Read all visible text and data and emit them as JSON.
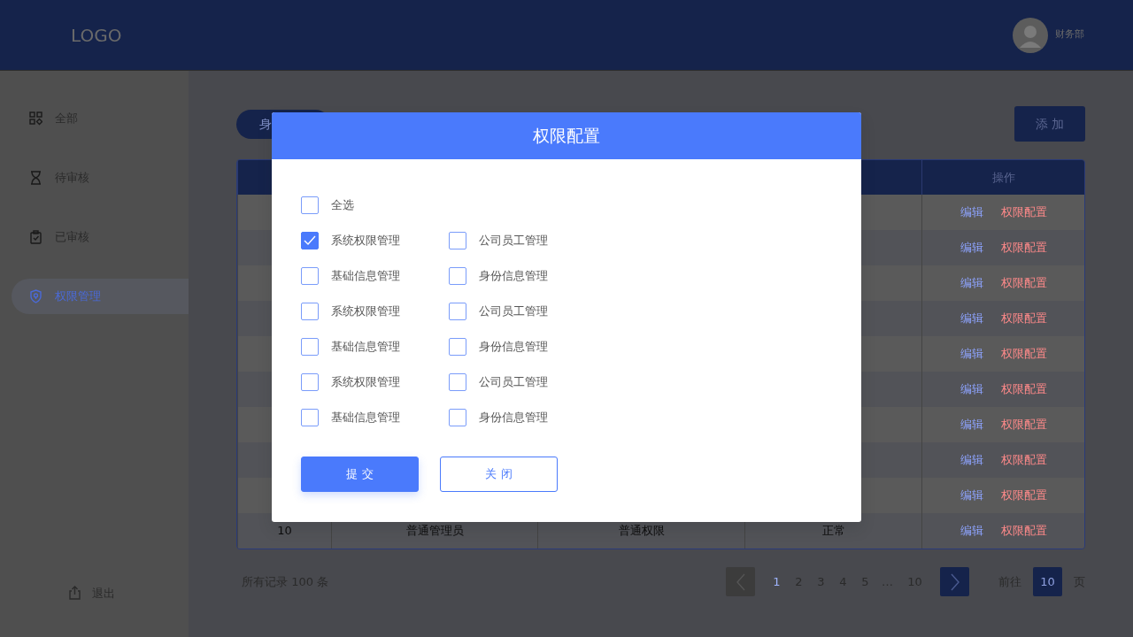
{
  "header": {
    "logo": "LOGO",
    "department": "财务部"
  },
  "sidebar": {
    "items": [
      {
        "label": "全部",
        "selected": false
      },
      {
        "label": "待审核",
        "selected": false
      },
      {
        "label": "已审核",
        "selected": false
      },
      {
        "label": "权限管理",
        "selected": true
      }
    ],
    "logout": "退出"
  },
  "toolbar": {
    "filter_tab": "身",
    "add_button": "添 加"
  },
  "table": {
    "action_column": "操作",
    "rows": [
      {
        "actions": [
          "编辑",
          "权限配置"
        ]
      },
      {
        "actions": [
          "编辑",
          "权限配置"
        ]
      },
      {
        "actions": [
          "编辑",
          "权限配置"
        ]
      },
      {
        "actions": [
          "编辑",
          "权限配置"
        ]
      },
      {
        "actions": [
          "编辑",
          "权限配置"
        ]
      },
      {
        "actions": [
          "编辑",
          "权限配置"
        ]
      },
      {
        "actions": [
          "编辑",
          "权限配置"
        ]
      },
      {
        "actions": [
          "编辑",
          "权限配置"
        ]
      },
      {
        "actions": [
          "编辑",
          "权限配置"
        ]
      },
      {
        "cells": [
          "10",
          "普通管理员",
          "普通权限",
          "正常"
        ],
        "actions": [
          "编辑",
          "权限配置"
        ]
      }
    ]
  },
  "pagination": {
    "summary": "所有记录 100 条",
    "prev_disabled": true,
    "pages": [
      {
        "label": "1",
        "selected": true
      },
      {
        "label": "2",
        "selected": false
      },
      {
        "label": "3",
        "selected": false
      },
      {
        "label": "4",
        "selected": false
      },
      {
        "label": "5",
        "selected": false
      },
      {
        "label": "…",
        "selected": false
      },
      {
        "label": "10",
        "selected": false
      }
    ],
    "goto_label": "前往",
    "goto_value": "10",
    "page_suffix": "页"
  },
  "modal": {
    "title": "权限配置",
    "select_all": {
      "label": "全选",
      "checked": false
    },
    "options": [
      [
        {
          "label": "系统权限管理",
          "checked": true
        },
        {
          "label": "公司员工管理",
          "checked": false
        }
      ],
      [
        {
          "label": "基础信息管理",
          "checked": false
        },
        {
          "label": "身份信息管理",
          "checked": false
        }
      ],
      [
        {
          "label": "系统权限管理",
          "checked": false
        },
        {
          "label": "公司员工管理",
          "checked": false
        }
      ],
      [
        {
          "label": "基础信息管理",
          "checked": false
        },
        {
          "label": "身份信息管理",
          "checked": false
        }
      ],
      [
        {
          "label": "系统权限管理",
          "checked": false
        },
        {
          "label": "公司员工管理",
          "checked": false
        }
      ],
      [
        {
          "label": "基础信息管理",
          "checked": false
        },
        {
          "label": "身份信息管理",
          "checked": false
        }
      ]
    ],
    "buttons": [
      {
        "label": "提 交",
        "kind": "primary"
      },
      {
        "label": "关 闭",
        "kind": "outline"
      }
    ]
  }
}
